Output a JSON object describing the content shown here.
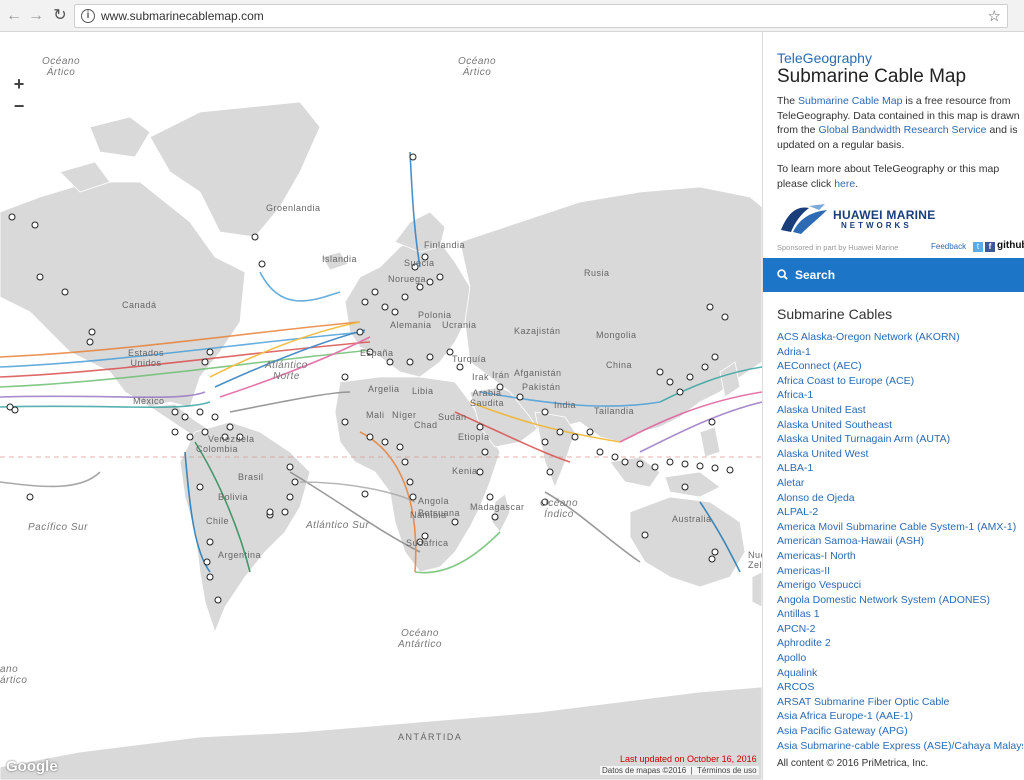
{
  "browser": {
    "url": "www.submarinecablemap.com"
  },
  "map": {
    "zoom_in": "+",
    "zoom_out": "−",
    "labels": {
      "oceano_artico_left": "Océano\nÁrtico",
      "oceano_artico_right": "Océano\nÁrtico",
      "groenlandia": "Groenlandia",
      "canada": "Canadá",
      "estados_unidos": "Estados\nUnidos",
      "mexico": "México",
      "atlantico_norte": "Atlántico\nNorte",
      "atlantico_sur": "Atlántico Sur",
      "pacifico_sur": "Pacífico Sur",
      "brasil": "Brasil",
      "bolivia": "Bolivia",
      "chile": "Chile",
      "argentina": "Argentina",
      "colombia": "Colombia",
      "venezuela": "Venezuela",
      "argelia": "Argelia",
      "libia": "Libia",
      "mali": "Mali",
      "niger": "Níger",
      "chad": "Chad",
      "sudan": "Sudán",
      "etiopia": "Etiopía",
      "kenia": "Kenia",
      "angola": "Angola",
      "namibia": "Namibia",
      "botsuana": "Botsuana",
      "sudafrica": "Sudáfrica",
      "madagascar": "Madagascar",
      "finlandia": "Finlandia",
      "suecia": "Suecia",
      "noruega": "Noruega",
      "islandia": "Islandia",
      "alemania": "Alemania",
      "polonia": "Polonia",
      "ucrania": "Ucrania",
      "espana": "España",
      "turquia": "Turquía",
      "iran": "Irán",
      "irak": "Irak",
      "arabia_saudita": "Arabia\nSaudita",
      "afganistan": "Afganistán",
      "pakistan": "Pakistán",
      "india": "India",
      "kazajistan": "Kazajistán",
      "mongolia": "Mongolia",
      "china": "China",
      "rusia": "Rusia",
      "tailandia": "Tailandia",
      "oceano_indico": "Océano\nÍndico",
      "australia": "Australia",
      "oceano_antartico": "Océano\nAntártico",
      "antartida": "ANTÁRTIDA",
      "ano_artico": "ano\nártico",
      "nueva_zelanda": "Nue\nZela"
    },
    "google_logo": "Google",
    "last_updated": "Last updated on October 16, 2016",
    "map_data_credit": "Datos de mapas ©2016",
    "terms": "Términos de uso"
  },
  "sidebar": {
    "brand": "TeleGeography",
    "title": "Submarine Cable Map",
    "intro_1": "The ",
    "intro_link_1": "Submarine Cable Map",
    "intro_2": " is a free resource from TeleGeography. Data contained in this map is drawn from the ",
    "intro_link_2": "Global Bandwidth Research Service",
    "intro_3": " and is updated on a regular basis.",
    "more_1": "To learn more about TeleGeography or this map please click ",
    "more_link": "here",
    "more_2": ".",
    "sponsor_logo_line1": "HUAWEI MARINE",
    "sponsor_logo_line2": "NETWORKS",
    "sponsor": "Sponsored in part by Huawei Marine",
    "feedback": "Feedback",
    "twitter": "t",
    "facebook": "f",
    "github": "github",
    "search_label": "Search",
    "list_heading": "Submarine Cables",
    "cables": [
      "ACS Alaska-Oregon Network (AKORN)",
      "Adria-1",
      "AEConnect (AEC)",
      "Africa Coast to Europe (ACE)",
      "Africa-1",
      "Alaska United East",
      "Alaska United Southeast",
      "Alaska United Turnagain Arm (AUTA)",
      "Alaska United West",
      "ALBA-1",
      "Aletar",
      "Alonso de Ojeda",
      "ALPAL-2",
      "America Movil Submarine Cable System-1 (AMX-1)",
      "American Samoa-Hawaii (ASH)",
      "Americas-I North",
      "Americas-II",
      "Amerigo Vespucci",
      "Angola Domestic Network System (ADONES)",
      "Antillas 1",
      "APCN-2",
      "Aphrodite 2",
      "Apollo",
      "Aqualink",
      "ARCOS",
      "ARSAT Submarine Fiber Optic Cable",
      "Asia Africa Europe-1 (AAE-1)",
      "Asia Pacific Gateway (APG)",
      "Asia Submarine-cable Express (ASE)/Cahaya Malaysia"
    ],
    "copyright": "All content © 2016 PriMetrica, Inc."
  },
  "colors": {
    "land": "#d9d9d9",
    "accent_blue": "#1d75c7",
    "link_blue": "#2c6bb3",
    "updated_red": "#cc0000"
  }
}
